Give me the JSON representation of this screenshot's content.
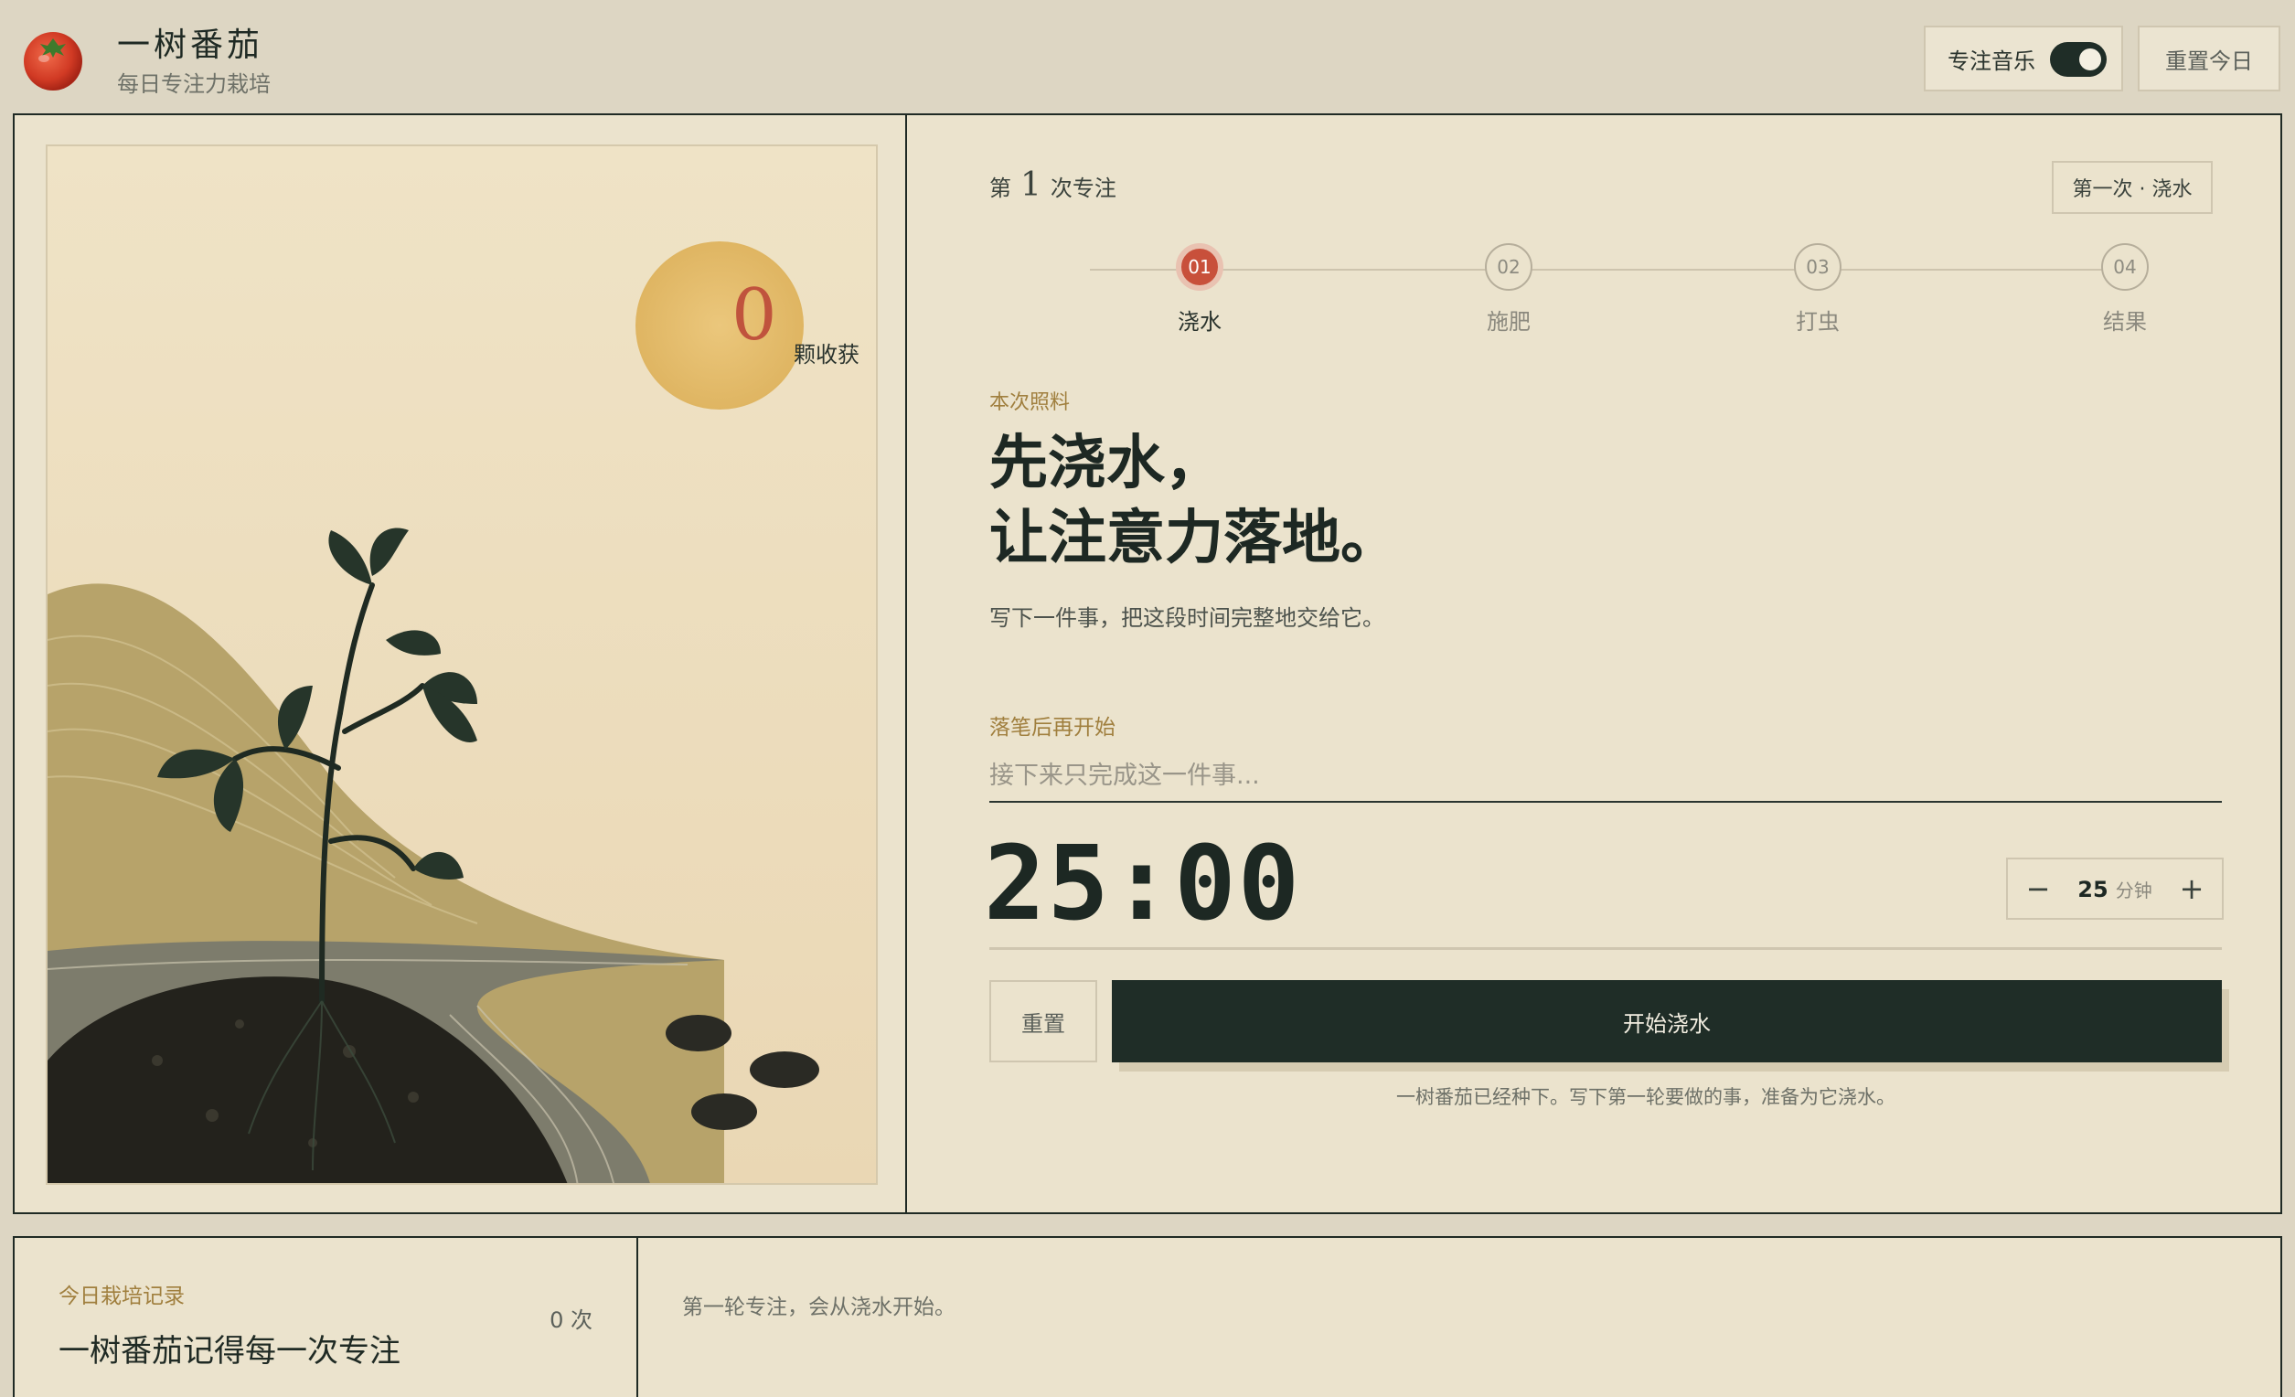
{
  "app": {
    "title": "一树番茄",
    "subtitle": "每日专注力栽培",
    "logo_icon": "tomato-icon"
  },
  "header": {
    "music_label": "专注音乐",
    "music_enabled": true,
    "reset_day_label": "重置今日"
  },
  "illustration": {
    "harvest_count": "0",
    "harvest_label": "颗收获",
    "scene": "tomato-seedling-sun-hill-stream"
  },
  "session": {
    "prefix": "第",
    "number": "1",
    "suffix": "次专注",
    "stage_tag": "第一次 · 浇水"
  },
  "steps": [
    {
      "num": "01",
      "label": "浇水",
      "active": true
    },
    {
      "num": "02",
      "label": "施肥",
      "active": false
    },
    {
      "num": "03",
      "label": "打虫",
      "active": false
    },
    {
      "num": "04",
      "label": "结果",
      "active": false
    }
  ],
  "care": {
    "label": "本次照料",
    "headline_line1": "先浇水，",
    "headline_line2": "让注意力落地。",
    "description": "写下一件事，把这段时间完整地交给它。"
  },
  "task": {
    "label": "落笔后再开始",
    "placeholder": "接下来只完成这一件事...",
    "value": ""
  },
  "timer": {
    "display": "25:00",
    "minutes": "25",
    "unit": "分钟",
    "minus_icon": "minus-icon",
    "plus_icon": "plus-icon"
  },
  "actions": {
    "reset_label": "重置",
    "start_label": "开始浇水",
    "hint": "一树番茄已经种下。写下第一轮要做的事，准备为它浇水。"
  },
  "record": {
    "label": "今日栽培记录",
    "title": "一树番茄记得每一次专注",
    "count": "0 次",
    "note": "第一轮专注，会从浇水开始。"
  },
  "colors": {
    "accent": "#c8503b",
    "dark": "#1f2d27",
    "gold": "#a07f3e",
    "paper": "#ebe3cd"
  }
}
